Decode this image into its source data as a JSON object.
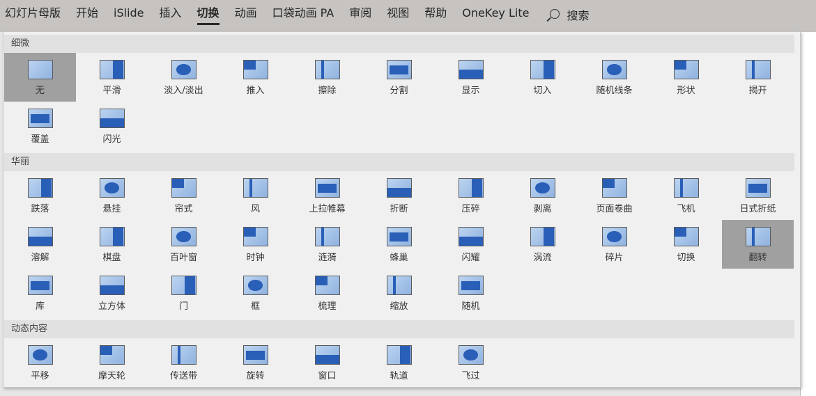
{
  "ribbon": {
    "tabs": [
      "幻灯片母版",
      "开始",
      "iSlide",
      "插入",
      "切换",
      "动画",
      "口袋动画 PA",
      "审阅",
      "视图",
      "帮助",
      "OneKey Lite"
    ],
    "active": "切换",
    "search_label": "搜索"
  },
  "sections": [
    {
      "title": "细微",
      "items": [
        {
          "label": "无",
          "icon": "none-icon",
          "selected": true
        },
        {
          "label": "平滑",
          "icon": "morph-icon"
        },
        {
          "label": "淡入/淡出",
          "icon": "fade-icon"
        },
        {
          "label": "推入",
          "icon": "push-icon"
        },
        {
          "label": "擦除",
          "icon": "wipe-icon"
        },
        {
          "label": "分割",
          "icon": "split-icon"
        },
        {
          "label": "显示",
          "icon": "reveal-icon"
        },
        {
          "label": "切入",
          "icon": "cut-icon"
        },
        {
          "label": "随机线条",
          "icon": "random-bars-icon"
        },
        {
          "label": "形状",
          "icon": "shape-icon"
        },
        {
          "label": "揭开",
          "icon": "uncover-icon"
        },
        {
          "label": "覆盖",
          "icon": "cover-icon"
        },
        {
          "label": "闪光",
          "icon": "flash-icon"
        }
      ]
    },
    {
      "title": "华丽",
      "items": [
        {
          "label": "跌落",
          "icon": "fall-over-icon"
        },
        {
          "label": "悬挂",
          "icon": "drape-icon"
        },
        {
          "label": "帘式",
          "icon": "curtains-icon"
        },
        {
          "label": "风",
          "icon": "wind-icon"
        },
        {
          "label": "上拉帷幕",
          "icon": "prestige-icon"
        },
        {
          "label": "折断",
          "icon": "fracture-icon"
        },
        {
          "label": "压碎",
          "icon": "crush-icon"
        },
        {
          "label": "剥离",
          "icon": "peel-off-icon"
        },
        {
          "label": "页面卷曲",
          "icon": "page-curl-icon"
        },
        {
          "label": "飞机",
          "icon": "airplane-icon"
        },
        {
          "label": "日式折纸",
          "icon": "origami-icon"
        },
        {
          "label": "溶解",
          "icon": "dissolve-icon"
        },
        {
          "label": "棋盘",
          "icon": "checkerboard-icon"
        },
        {
          "label": "百叶窗",
          "icon": "blinds-icon"
        },
        {
          "label": "时钟",
          "icon": "clock-icon"
        },
        {
          "label": "涟漪",
          "icon": "ripple-icon"
        },
        {
          "label": "蜂巢",
          "icon": "honeycomb-icon"
        },
        {
          "label": "闪耀",
          "icon": "glitter-icon"
        },
        {
          "label": "涡流",
          "icon": "vortex-icon"
        },
        {
          "label": "碎片",
          "icon": "shred-icon"
        },
        {
          "label": "切换",
          "icon": "switch-icon"
        },
        {
          "label": "翻转",
          "icon": "flip-icon",
          "selected": true
        },
        {
          "label": "库",
          "icon": "gallery-icon"
        },
        {
          "label": "立方体",
          "icon": "cube-icon"
        },
        {
          "label": "门",
          "icon": "doors-icon"
        },
        {
          "label": "框",
          "icon": "box-icon"
        },
        {
          "label": "梳理",
          "icon": "comb-icon"
        },
        {
          "label": "缩放",
          "icon": "zoom-icon"
        },
        {
          "label": "随机",
          "icon": "random-icon"
        }
      ]
    },
    {
      "title": "动态内容",
      "items": [
        {
          "label": "平移",
          "icon": "pan-icon"
        },
        {
          "label": "摩天轮",
          "icon": "ferris-wheel-icon"
        },
        {
          "label": "传送带",
          "icon": "conveyor-icon"
        },
        {
          "label": "旋转",
          "icon": "rotate-icon"
        },
        {
          "label": "窗口",
          "icon": "window-icon"
        },
        {
          "label": "轨道",
          "icon": "orbit-icon"
        },
        {
          "label": "飞过",
          "icon": "fly-through-icon"
        }
      ]
    }
  ]
}
